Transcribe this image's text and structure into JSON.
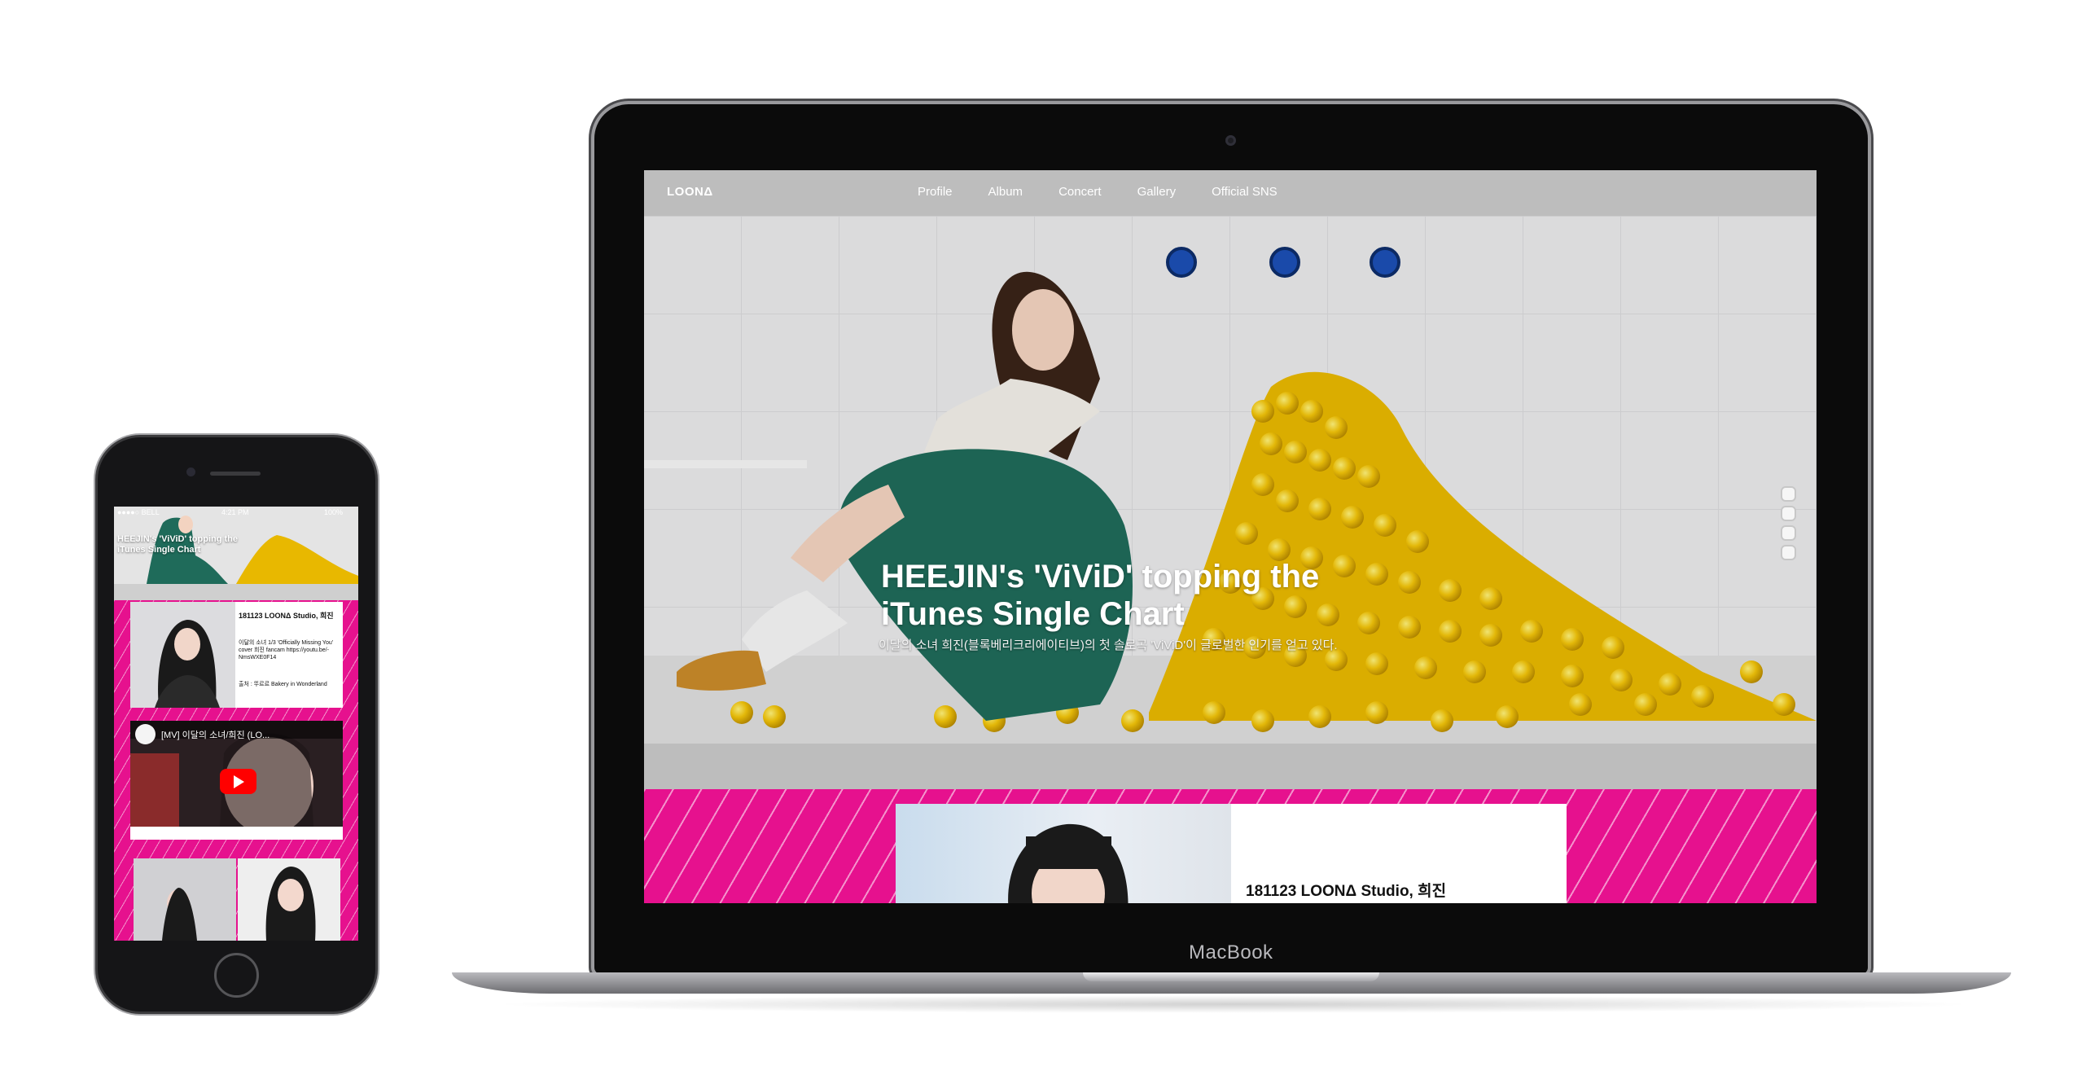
{
  "laptop": {
    "brand_label": "MacBook",
    "site": {
      "logo": "LOONΔ",
      "nav": [
        "Profile",
        "Album",
        "Concert",
        "Gallery",
        "Official SNS"
      ],
      "hero": {
        "title": "HEEJIN's 'ViViD' topping the iTunes Single Chart",
        "description": "이달의 소녀 희진(블록베리크리에이티브)의 첫 솔로곡 'ViViD'이 글로벌한 인기를 얻고 있다.",
        "slide_count": 4
      },
      "card": {
        "title": "181123 LOONΔ Studio, 희진"
      }
    }
  },
  "phone": {
    "status": {
      "carrier": "●●●●○ BELL",
      "time": "4:21 PM",
      "battery": "100%"
    },
    "hero_title": "HEEJIN's 'ViViD' topping the iTunes Single Chart",
    "card": {
      "title": "181123 LOONΔ Studio, 희진",
      "body": "이달의 소녀 1/3 'Officially Missing You' cover 희진 fancam https://youtu.be/-NmsWXE0F14",
      "source": "출처 : 뚜르르 Bakery in Wonderland"
    },
    "video_title": "[MV] 이달의 소녀/희진 (LO..."
  },
  "colors": {
    "accent_pink": "#e6118e",
    "nav_gray": "#bdbdbd",
    "ball_yellow": "#f2c40a",
    "dress_green": "#1f6b5a"
  },
  "icons": [
    "camera-icon",
    "speaker-icon",
    "home-button-icon",
    "youtube-play-icon"
  ]
}
